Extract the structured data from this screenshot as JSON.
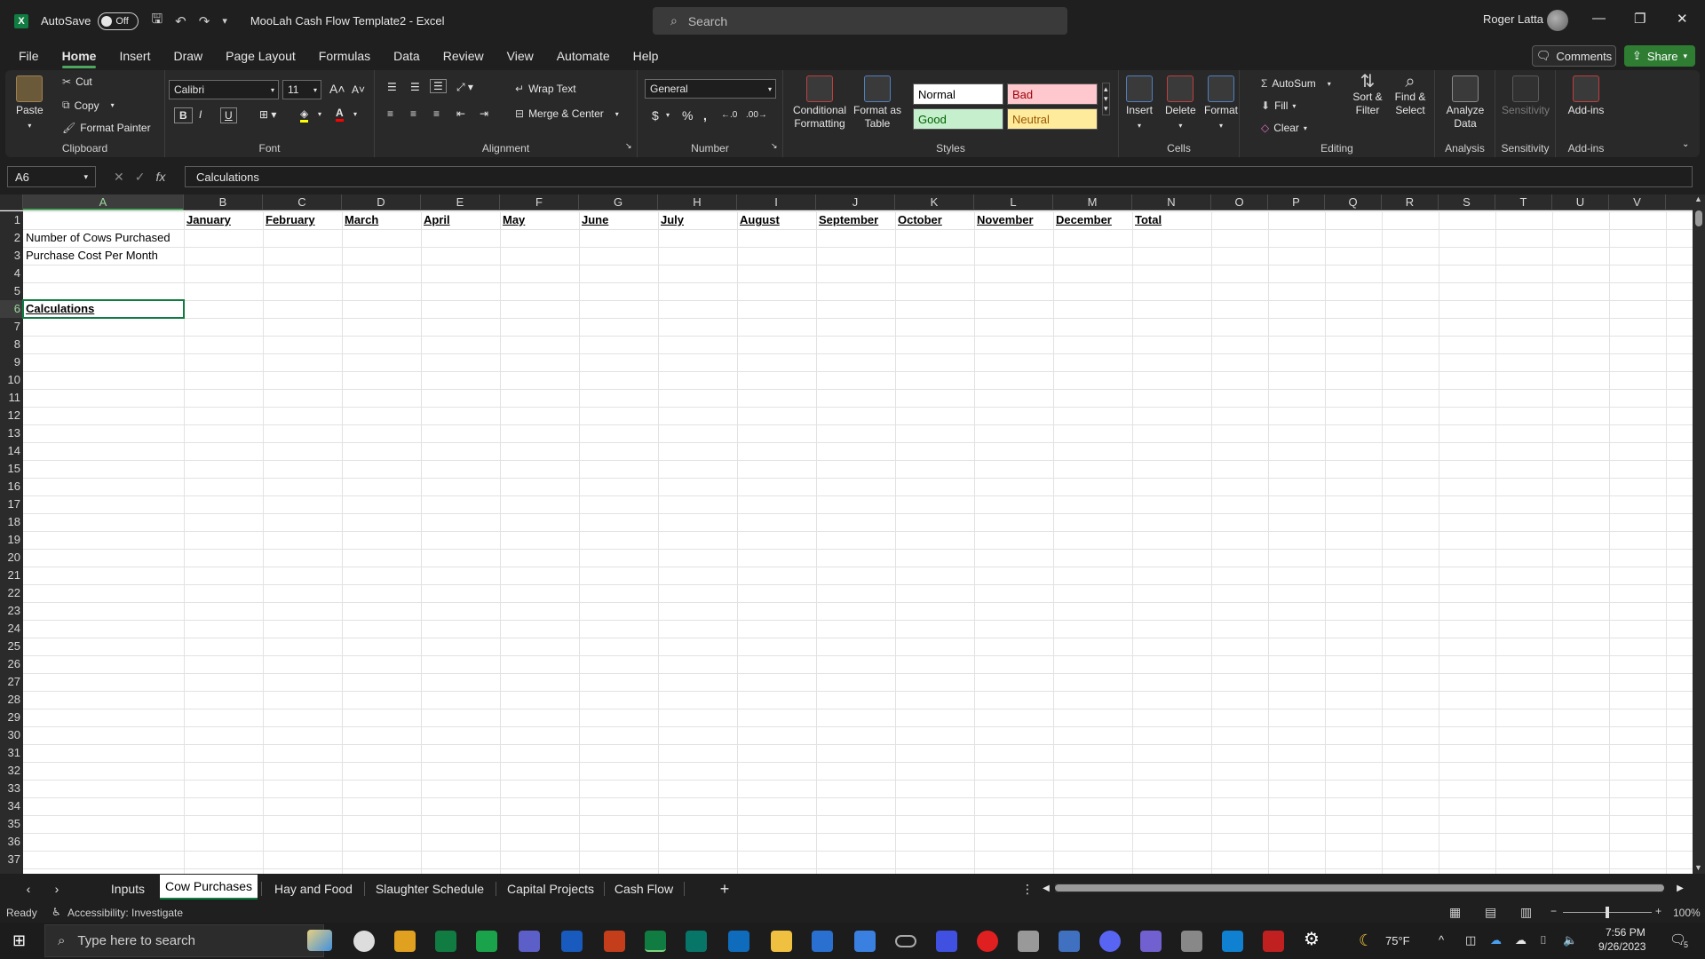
{
  "titlebar": {
    "autosave_label": "AutoSave",
    "autosave_state": "Off",
    "doc_title": "MooLah Cash Flow Template2  -  Excel",
    "search_placeholder": "Search",
    "user_name": "Roger Latta"
  },
  "menu": {
    "items": [
      "File",
      "Home",
      "Insert",
      "Draw",
      "Page Layout",
      "Formulas",
      "Data",
      "Review",
      "View",
      "Automate",
      "Help"
    ],
    "active": "Home",
    "comments_label": "Comments",
    "share_label": "Share"
  },
  "ribbon": {
    "clipboard": {
      "paste": "Paste",
      "cut": "Cut",
      "copy": "Copy",
      "format_painter": "Format Painter",
      "label": "Clipboard"
    },
    "font": {
      "name": "Calibri",
      "size": "11",
      "label": "Font",
      "bold": "B",
      "italic": "I",
      "underline": "U"
    },
    "alignment": {
      "wrap_text": "Wrap Text",
      "merge_center": "Merge & Center",
      "label": "Alignment"
    },
    "number": {
      "format": "General",
      "label": "Number",
      "currency": "$",
      "percent": "%"
    },
    "styles": {
      "conditional": "Conditional Formatting",
      "format_table": "Format as Table",
      "normal": "Normal",
      "bad": "Bad",
      "good": "Good",
      "neutral": "Neutral",
      "label": "Styles"
    },
    "cells": {
      "insert": "Insert",
      "delete": "Delete",
      "format": "Format",
      "label": "Cells"
    },
    "editing": {
      "autosum": "AutoSum",
      "fill": "Fill",
      "clear": "Clear",
      "sort_filter": "Sort & Filter",
      "find_select": "Find & Select",
      "label": "Editing"
    },
    "analysis": {
      "analyze": "Analyze Data",
      "label": "Analysis"
    },
    "sensitivity": {
      "button": "Sensitivity",
      "label": "Sensitivity"
    },
    "addins": {
      "button": "Add-ins",
      "label": "Add-ins"
    }
  },
  "formula_bar": {
    "name_box": "A6",
    "content": "Calculations"
  },
  "columns": [
    "A",
    "B",
    "C",
    "D",
    "E",
    "F",
    "G",
    "H",
    "I",
    "J",
    "K",
    "L",
    "M",
    "N",
    "O",
    "P",
    "Q",
    "R",
    "S",
    "T",
    "U",
    "V"
  ],
  "rows": [
    "1",
    "2",
    "3",
    "4",
    "5",
    "6",
    "7",
    "8",
    "9",
    "10",
    "11",
    "12",
    "13",
    "14",
    "15",
    "16",
    "17",
    "18",
    "19",
    "20",
    "21",
    "22",
    "23",
    "24",
    "25",
    "26",
    "27",
    "28",
    "29",
    "30",
    "31",
    "32",
    "33",
    "34",
    "35",
    "36",
    "37"
  ],
  "cells": {
    "B1": "January",
    "C1": "February",
    "D1": "March",
    "E1": "April",
    "F1": "May",
    "G1": "June",
    "H1": "July",
    "I1": "August",
    "J1": "September",
    "K1": "October",
    "L1": "November",
    "M1": "December",
    "N1": "Total",
    "A2": "Number of Cows Purchased",
    "A3": "Purchase Cost Per Month",
    "A6": "Calculations"
  },
  "sheet_tabs": [
    "Inputs",
    "Cow Purchases",
    "Hay and Food",
    "Slaughter Schedule",
    "Capital Projects",
    "Cash Flow"
  ],
  "active_tab": "Cow Purchases",
  "status": {
    "ready": "Ready",
    "accessibility": "Accessibility: Investigate",
    "zoom": "100%"
  },
  "taskbar": {
    "search_placeholder": "Type here to search",
    "weather": "75°F",
    "time": "7:56 PM",
    "date": "9/26/2023",
    "notification_count": "5"
  },
  "colors": {
    "accent_green": "#107c41",
    "share_green": "#2e7d32",
    "bad_bg": "#ffc7ce",
    "good_bg": "#c6efce",
    "neutral_bg": "#ffeb9c"
  }
}
